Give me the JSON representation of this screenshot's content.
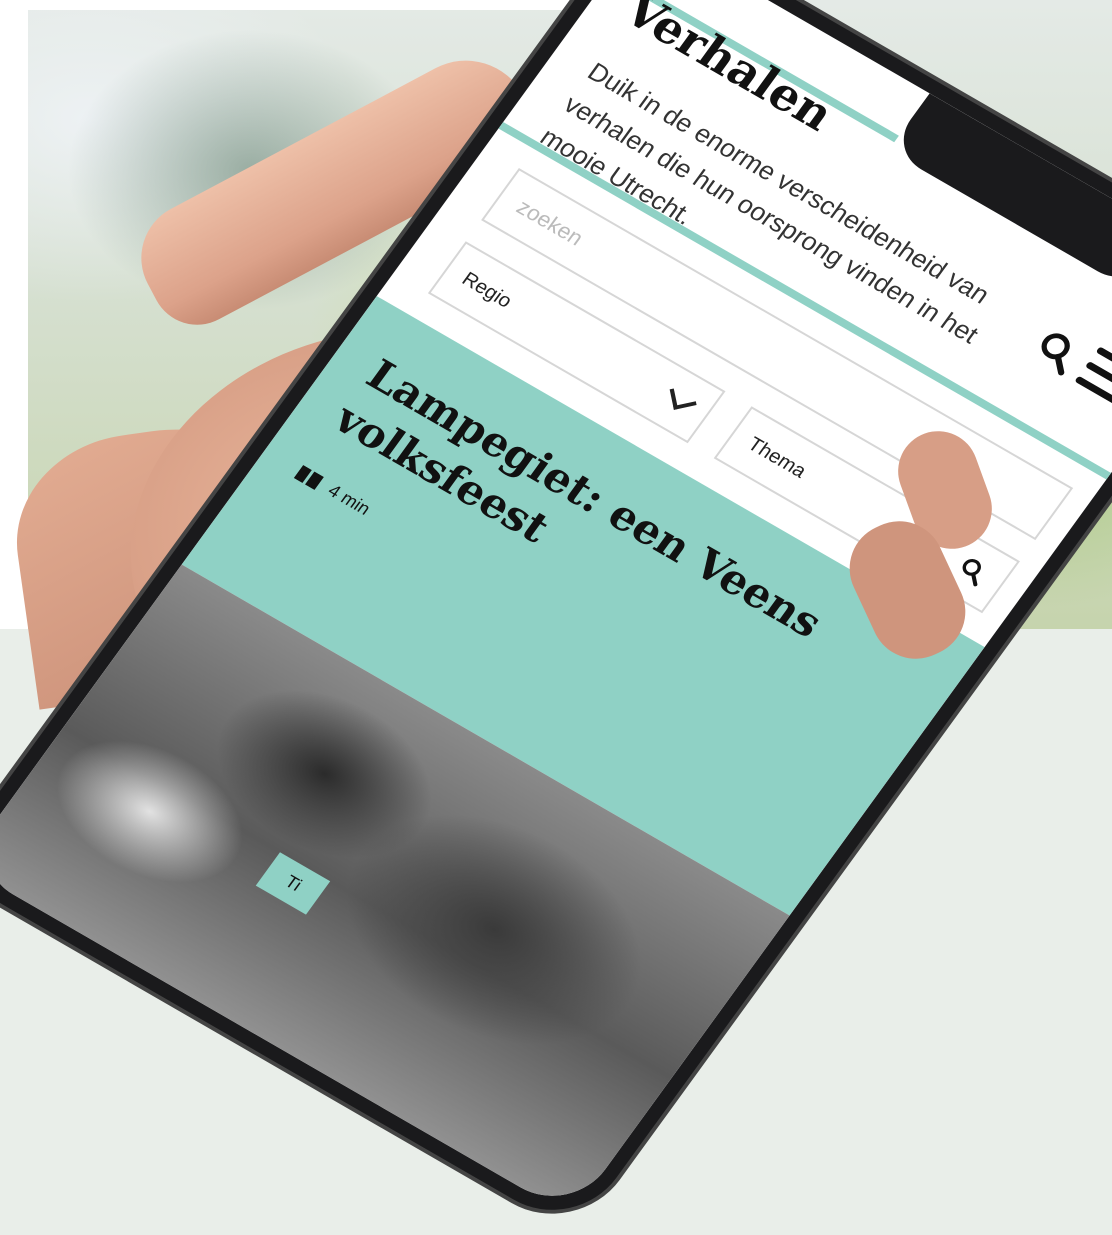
{
  "app": {
    "title": "Verhalen",
    "intro": "Duik in de enorme verscheidenheid van verhalen die hun oorsprong vinden in het mooie Utrecht."
  },
  "colors": {
    "accent": "#8fd1c5",
    "text": "#111111",
    "border": "#d6d6d6"
  },
  "header": {
    "icons": [
      "search-icon",
      "menu-icon"
    ]
  },
  "search": {
    "placeholder": "zoeken",
    "value": ""
  },
  "filters": {
    "regio_label": "Regio",
    "thema_label": "Thema"
  },
  "card": {
    "title": "Lampegiet: een Veens volksfeest",
    "read_time": "4 min",
    "tag": "Ti"
  }
}
